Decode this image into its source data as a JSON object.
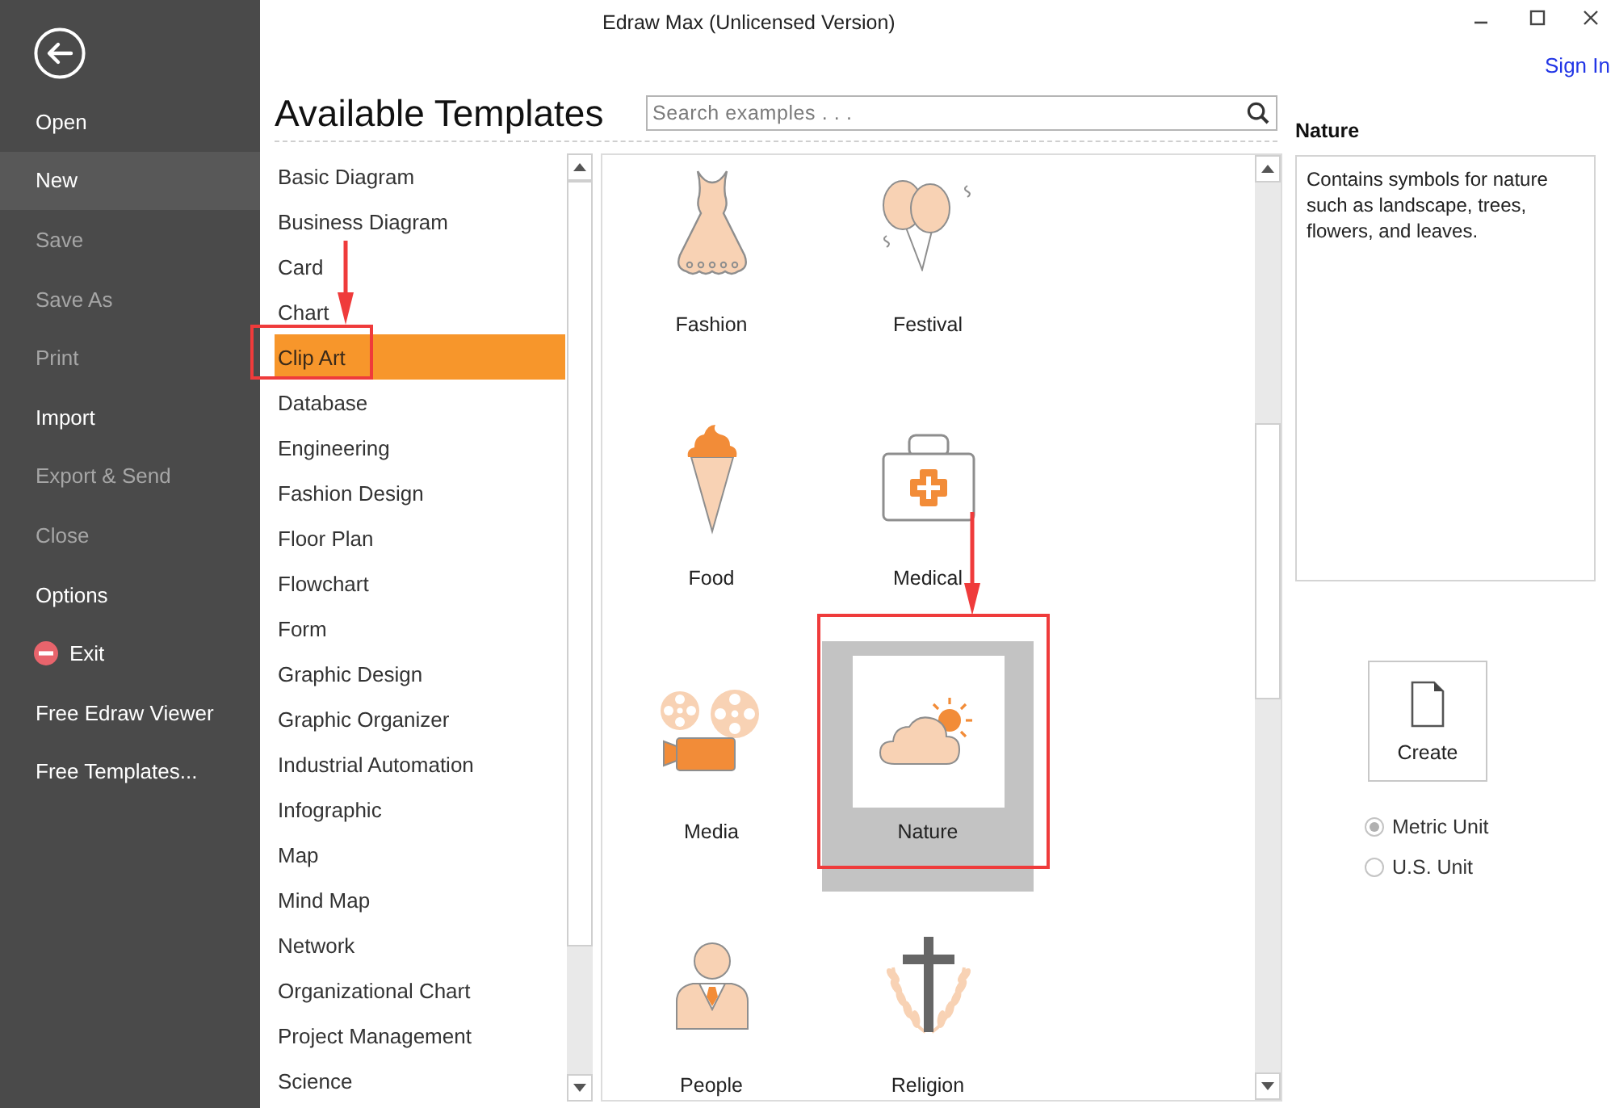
{
  "window": {
    "title": "Edraw Max (Unlicensed Version)",
    "sign_in": "Sign In"
  },
  "sidebar": {
    "items": [
      {
        "label": "Open",
        "kind": "plain",
        "selected": false,
        "disabled": false
      },
      {
        "label": "New",
        "kind": "plain",
        "selected": true,
        "disabled": false
      },
      {
        "label": "Save",
        "kind": "plain",
        "selected": false,
        "disabled": true
      },
      {
        "label": "Save As",
        "kind": "plain",
        "selected": false,
        "disabled": true
      },
      {
        "label": "Print",
        "kind": "plain",
        "selected": false,
        "disabled": true
      },
      {
        "label": "Import",
        "kind": "plain",
        "selected": false,
        "disabled": false
      },
      {
        "label": "Export & Send",
        "kind": "plain",
        "selected": false,
        "disabled": true
      },
      {
        "label": "Close",
        "kind": "plain",
        "selected": false,
        "disabled": true
      },
      {
        "label": "Options",
        "kind": "plain",
        "selected": false,
        "disabled": false
      },
      {
        "label": "Exit",
        "kind": "with-icon",
        "selected": false,
        "disabled": false
      },
      {
        "label": "Free Edraw Viewer",
        "kind": "plain",
        "selected": false,
        "disabled": false
      },
      {
        "label": "Free Templates...",
        "kind": "plain",
        "selected": false,
        "disabled": false
      }
    ]
  },
  "heading": "Available Templates",
  "search": {
    "placeholder": "Search examples . . ."
  },
  "categories": [
    {
      "label": "Basic Diagram",
      "selected": false,
      "annotated": false
    },
    {
      "label": "Business Diagram",
      "selected": false,
      "annotated": false
    },
    {
      "label": "Card",
      "selected": false,
      "annotated": false
    },
    {
      "label": "Chart",
      "selected": false,
      "annotated": false
    },
    {
      "label": "Clip Art",
      "selected": true,
      "annotated": true
    },
    {
      "label": "Database",
      "selected": false,
      "annotated": false
    },
    {
      "label": "Engineering",
      "selected": false,
      "annotated": false
    },
    {
      "label": "Fashion Design",
      "selected": false,
      "annotated": false
    },
    {
      "label": "Floor Plan",
      "selected": false,
      "annotated": false
    },
    {
      "label": "Flowchart",
      "selected": false,
      "annotated": false
    },
    {
      "label": "Form",
      "selected": false,
      "annotated": false
    },
    {
      "label": "Graphic Design",
      "selected": false,
      "annotated": false
    },
    {
      "label": "Graphic Organizer",
      "selected": false,
      "annotated": false
    },
    {
      "label": "Industrial Automation",
      "selected": false,
      "annotated": false
    },
    {
      "label": "Infographic",
      "selected": false,
      "annotated": false
    },
    {
      "label": "Map",
      "selected": false,
      "annotated": false
    },
    {
      "label": "Mind Map",
      "selected": false,
      "annotated": false
    },
    {
      "label": "Network",
      "selected": false,
      "annotated": false
    },
    {
      "label": "Organizational Chart",
      "selected": false,
      "annotated": false
    },
    {
      "label": "Project Management",
      "selected": false,
      "annotated": false
    },
    {
      "label": "Science",
      "selected": false,
      "annotated": false
    }
  ],
  "templates": [
    {
      "label": "Fashion",
      "selected": false,
      "annotated": false
    },
    {
      "label": "Festival",
      "selected": false,
      "annotated": false
    },
    {
      "label": "Food",
      "selected": false,
      "annotated": false
    },
    {
      "label": "Medical",
      "selected": false,
      "annotated": false
    },
    {
      "label": "Media",
      "selected": false,
      "annotated": false
    },
    {
      "label": "Nature",
      "selected": true,
      "annotated": true
    },
    {
      "label": "People",
      "selected": false,
      "annotated": false
    },
    {
      "label": "Religion",
      "selected": false,
      "annotated": false
    }
  ],
  "details": {
    "title": "Nature",
    "description": "Contains symbols for nature such as landscape, trees, flowers, and leaves.",
    "create_button": "Create",
    "units": [
      {
        "label": "Metric Unit",
        "selected": true
      },
      {
        "label": "U.S. Unit",
        "selected": false
      }
    ]
  }
}
